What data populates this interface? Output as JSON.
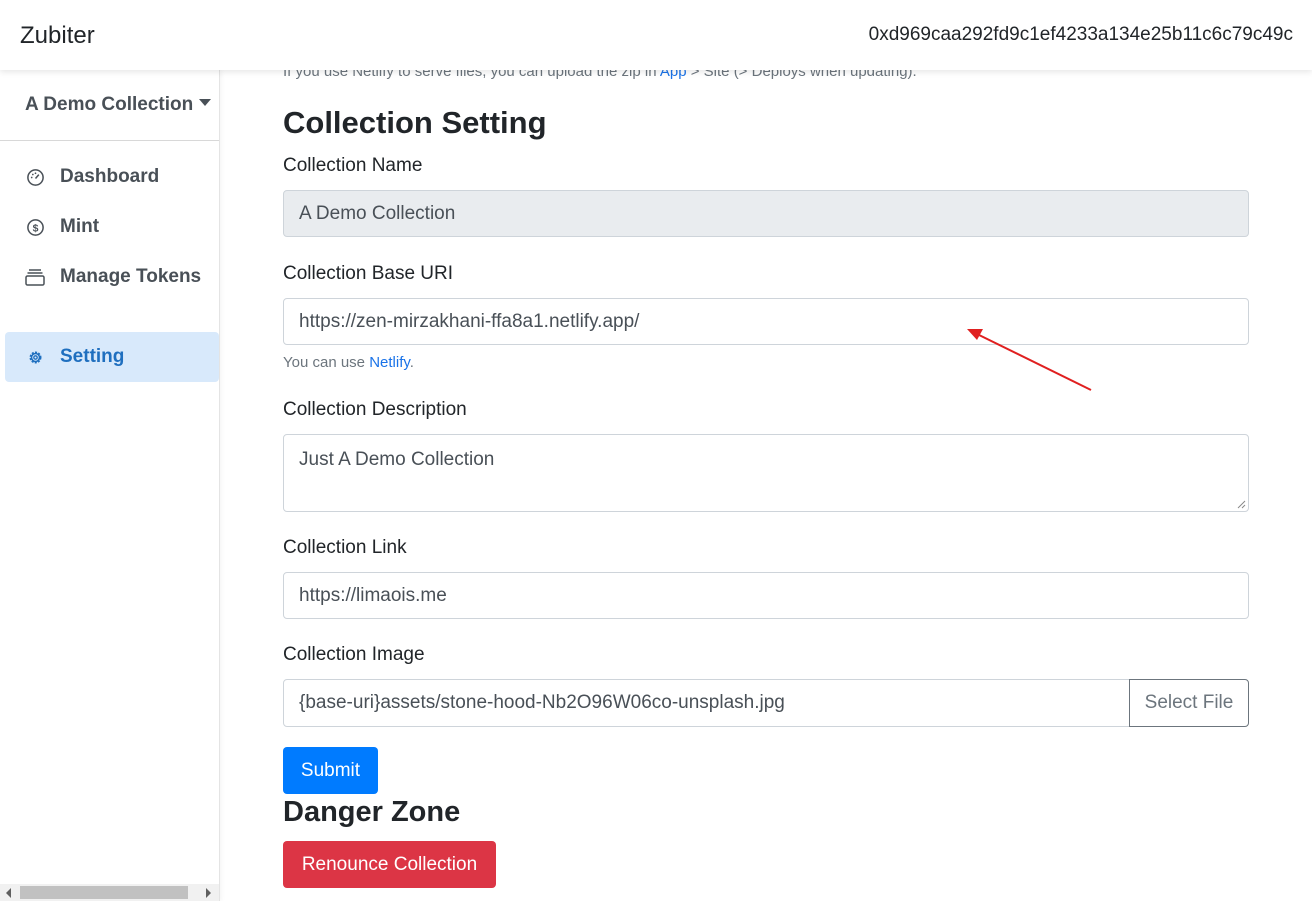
{
  "app": {
    "brand": "Zubiter",
    "wallet_address": "0xd969caa292fd9c1ef4233a134e25b11c6c79c49c"
  },
  "sidebar": {
    "collection_selector": "A Demo Collection",
    "items": [
      {
        "label": "Dashboard",
        "icon": "dashboard-gauge-icon"
      },
      {
        "label": "Mint",
        "icon": "dollar-coin-icon"
      },
      {
        "label": "Manage Tokens",
        "icon": "collection-stack-icon"
      },
      {
        "label": "Setting",
        "icon": "gear-icon",
        "active": true
      }
    ]
  },
  "main": {
    "notice": {
      "before": "If you use Netlify to serve files, you can upload the zip in ",
      "link": "App",
      "after": " > Site (> Deploys when updating)."
    },
    "title": "Collection Setting",
    "fields": {
      "name": {
        "label": "Collection Name",
        "value": "A Demo Collection"
      },
      "base_uri": {
        "label": "Collection Base URI",
        "value": "https://zen-mirzakhani-ffa8a1.netlify.app/",
        "help_before": "You can use ",
        "help_link": "Netlify",
        "help_after": "."
      },
      "description": {
        "label": "Collection Description",
        "value": "Just A Demo Collection"
      },
      "link": {
        "label": "Collection Link",
        "value": "https://limaois.me"
      },
      "image": {
        "label": "Collection Image",
        "value": "{base-uri}assets/stone-hood-Nb2O96W06co-unsplash.jpg",
        "button": "Select File"
      }
    },
    "submit_label": "Submit",
    "danger_title": "Danger Zone",
    "renounce_label": "Renounce Collection"
  },
  "colors": {
    "primary": "#007bff",
    "danger": "#dc3545",
    "active_nav_bg": "#d8e9fb",
    "active_nav_text": "#1f6fbf",
    "annotation_arrow": "#e02020"
  }
}
